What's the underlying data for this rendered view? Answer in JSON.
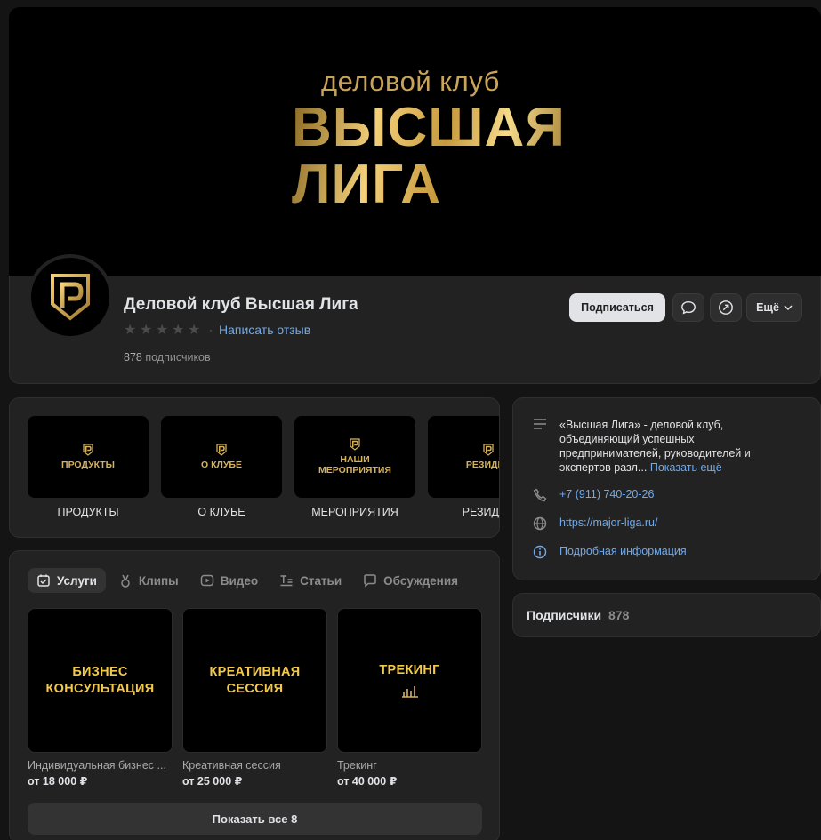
{
  "cover": {
    "subtitle": "деловой клуб",
    "title_line1": "ВЫСШАЯ",
    "title_line2": "ЛИГА"
  },
  "profile": {
    "name": "Деловой клуб Высшая Лига",
    "rating_stars": 0,
    "review_link": "Написать отзыв",
    "subscribers_count": "878",
    "subscribers_label": "подписчиков",
    "subscribe_button": "Подписаться",
    "more_button": "Ещё"
  },
  "menu": {
    "items": [
      {
        "tile_text": "ПРОДУКТЫ",
        "label": "ПРОДУКТЫ"
      },
      {
        "tile_text": "О КЛУБЕ",
        "label": "О КЛУБЕ"
      },
      {
        "tile_text": "НАШИ\nМЕРОПРИЯТИЯ",
        "label": "МЕРОПРИЯТИЯ"
      },
      {
        "tile_text": "РЕЗИДЕН",
        "label": "РЕЗИДЕН"
      }
    ]
  },
  "tabs": [
    {
      "label": "Услуги",
      "icon": "services-icon",
      "active": true
    },
    {
      "label": "Клипы",
      "icon": "clips-icon",
      "active": false
    },
    {
      "label": "Видео",
      "icon": "video-icon",
      "active": false
    },
    {
      "label": "Статьи",
      "icon": "articles-icon",
      "active": false
    },
    {
      "label": "Обсуждения",
      "icon": "discussions-icon",
      "active": false
    }
  ],
  "products": [
    {
      "image_text": "БИЗНЕС\nКОНСУЛЬТАЦИЯ",
      "name": "Индивидуальная бизнес ...",
      "price": "от 18 000 ₽"
    },
    {
      "image_text": "КРЕАТИВНАЯ\nСЕССИЯ",
      "name": "Креативная сессия",
      "price": "от 25 000 ₽"
    },
    {
      "image_text": "ТРЕКИНГ",
      "name": "Трекинг",
      "price": "от 40 000 ₽"
    }
  ],
  "show_all": "Показать все 8",
  "info": {
    "description": "«Высшая Лига» - деловой клуб, объединяющий успешных предпринимателей, руководителей и экспертов разл...",
    "show_more": "Показать ещё",
    "phone": "+7 (911) 740-20-26",
    "website": "https://major-liga.ru/",
    "details": "Подробная информация"
  },
  "subscribers_card": {
    "title": "Подписчики",
    "count": "878"
  },
  "colors": {
    "background": "#141414",
    "card": "#222222",
    "link": "#71aaeb",
    "gold": "#d6b25d"
  }
}
